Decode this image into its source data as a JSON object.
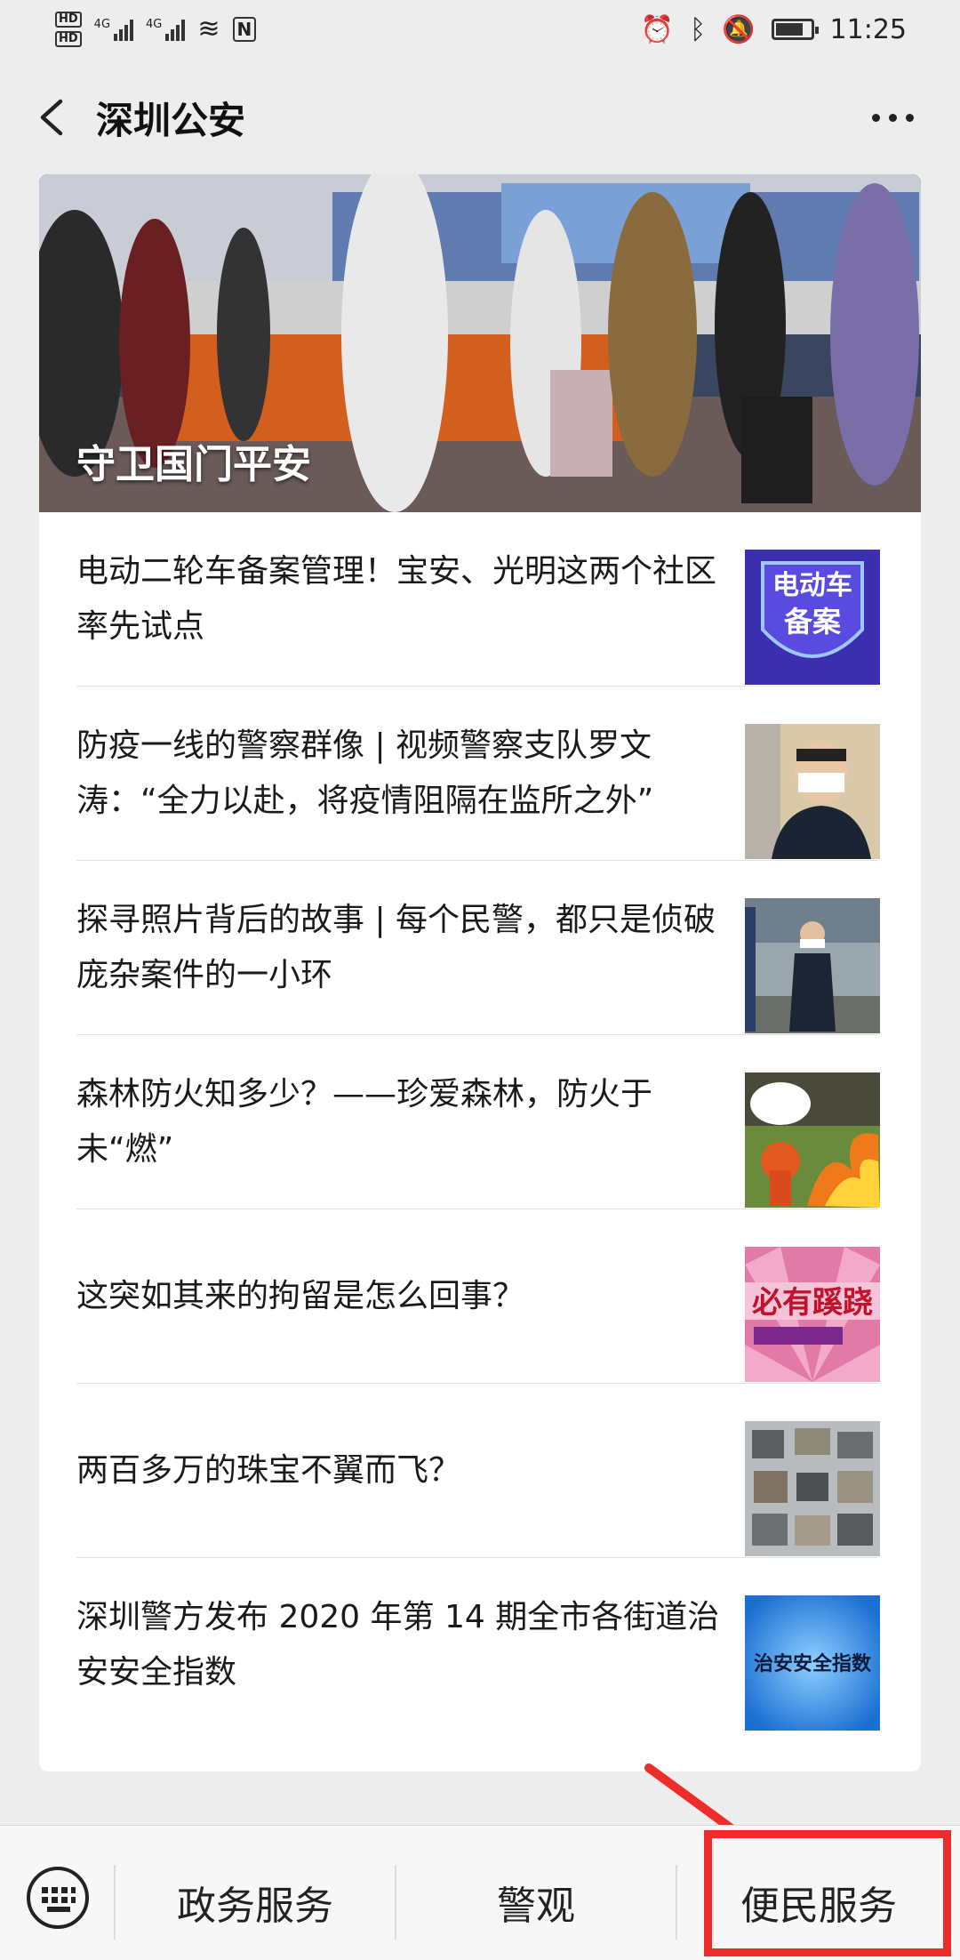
{
  "status_bar": {
    "hd1": "HD",
    "hd2": "HD",
    "network1": "4G",
    "network2": "4G",
    "time": "11:25",
    "battery_level": 0.8,
    "icons": [
      "hd-icon",
      "signal-icon",
      "wifi-icon",
      "nfc-icon",
      "alarm-icon",
      "bluetooth-icon",
      "mute-icon",
      "battery-icon"
    ]
  },
  "header": {
    "title": "深圳公安",
    "back_icon": "chevron-left-icon",
    "more_icon": "more-dots-icon"
  },
  "hero": {
    "caption": "守卫国门平安"
  },
  "articles": [
    {
      "title": "电动二轮车备案管理！宝安、光明这两个社区率先试点",
      "thumb_text": "电动车备案"
    },
    {
      "title": "防疫一线的警察群像 | 视频警察支队罗文涛：“全力以赴，将疫情阻隔在监所之外”"
    },
    {
      "title": "探寻照片背后的故事 | 每个民警，都只是侦破庞杂案件的一小环"
    },
    {
      "title": "森林防火知多少？——珍爱森林，防火于未“燃”"
    },
    {
      "title": "这突如其来的拘留是怎么回事？",
      "thumb_text": "必有蹊跷"
    },
    {
      "title": "两百多万的珠宝不翼而飞？"
    },
    {
      "title": "深圳警方发布 2020 年第 14 期全市各街道治安安全指数",
      "thumb_text": "治安安全指数"
    }
  ],
  "bottom_menu": {
    "keyboard_icon": "keyboard-icon",
    "items": [
      "政务服务",
      "警观",
      "便民服务"
    ]
  },
  "colors": {
    "highlight": "#ec2d2a",
    "background": "#ededed"
  }
}
